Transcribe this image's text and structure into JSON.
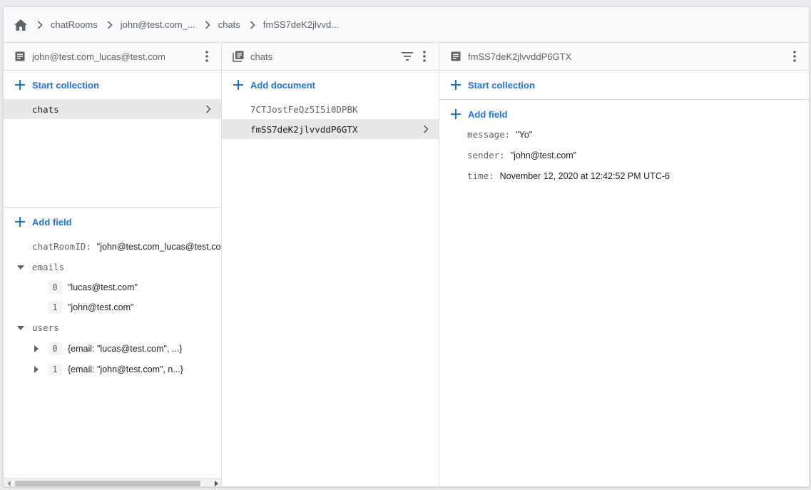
{
  "breadcrumb": {
    "items": [
      "chatRooms",
      "john@test.com_...",
      "chats",
      "fmSS7deK2jlvvd..."
    ]
  },
  "panel_root": {
    "title": "john@test.com_lucas@test.com",
    "start_collection_label": "Start collection",
    "collections": [
      {
        "label": "chats"
      }
    ],
    "add_field_label": "Add field",
    "fields": {
      "chatRoomID": {
        "key": "chatRoomID:",
        "value": "\"john@test.com_lucas@test.co"
      },
      "emails": {
        "key": "emails",
        "items": [
          {
            "index": "0",
            "value": "\"lucas@test.com\""
          },
          {
            "index": "1",
            "value": "\"john@test.com\""
          }
        ]
      },
      "users": {
        "key": "users",
        "items": [
          {
            "index": "0",
            "value": "{email: \"lucas@test.com\", ...}"
          },
          {
            "index": "1",
            "value": "{email: \"john@test.com\", n...}"
          }
        ]
      }
    }
  },
  "panel_collection": {
    "title": "chats",
    "add_document_label": "Add document",
    "documents": [
      {
        "id": "7CTJostFeQz5I5i0DPBK"
      },
      {
        "id": "fmSS7deK2jlvvddP6GTX"
      }
    ]
  },
  "panel_document": {
    "title": "fmSS7deK2jlvvddP6GTX",
    "start_collection_label": "Start collection",
    "add_field_label": "Add field",
    "fields": [
      {
        "key": "message:",
        "value": "\"Yo\""
      },
      {
        "key": "sender:",
        "value": "\"john@test.com\""
      },
      {
        "key": "time:",
        "value": "November 12, 2020 at 12:42:52 PM UTC-6"
      }
    ]
  },
  "colors": {
    "accent": "#1a73e8",
    "muted_text": "#5f6368",
    "selected_row": "#e8e8e8",
    "border": "#dadce0"
  },
  "icons": {
    "home": "home-icon",
    "breadcrumb_separator": "chevron-right-icon",
    "document": "document-icon",
    "collection": "collection-icon",
    "filter": "filter-icon",
    "more": "more-vert-icon",
    "add": "plus-icon",
    "expand": "caret-down-icon",
    "collapse": "caret-right-icon"
  }
}
